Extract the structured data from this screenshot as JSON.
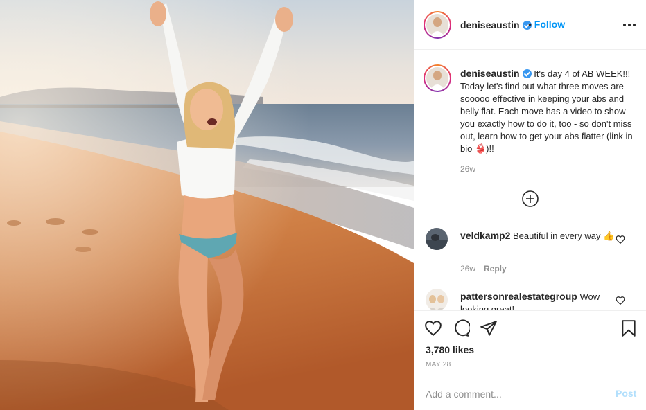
{
  "post": {
    "author": "deniseaustin",
    "verified": true,
    "follow_separator": "•",
    "follow_label": "Follow",
    "caption": "It's day 4 of AB WEEK!!! Today let's find out what three moves are sooooo effective in keeping your abs and belly flat. Each move has a video to show you exactly how to do it, too - so don't miss out, learn how to get your abs flatter (link in bio 👙)!!",
    "caption_time": "26w",
    "likes": "3,780 likes",
    "date": "MAY 28"
  },
  "comments": [
    {
      "user": "veldkamp2",
      "text": "Beautiful in every way 👍",
      "time": "26w",
      "reply_label": "Reply"
    },
    {
      "user": "pattersonrealestategroup",
      "text": "Wow looking great!"
    }
  ],
  "add_comment": {
    "placeholder": "Add a comment...",
    "post_label": "Post"
  },
  "icons": {
    "more": "more-options-icon",
    "load_more": "plus-circle-icon",
    "like": "heart-icon",
    "comment": "comment-icon",
    "share": "paper-plane-icon",
    "save": "bookmark-icon",
    "verified": "verified-badge-icon"
  },
  "colors": {
    "accent": "#0095f6",
    "verified": "#3897f0",
    "post_disabled": "#b2dffc",
    "muted": "#8e8e8e",
    "text": "#262626"
  }
}
